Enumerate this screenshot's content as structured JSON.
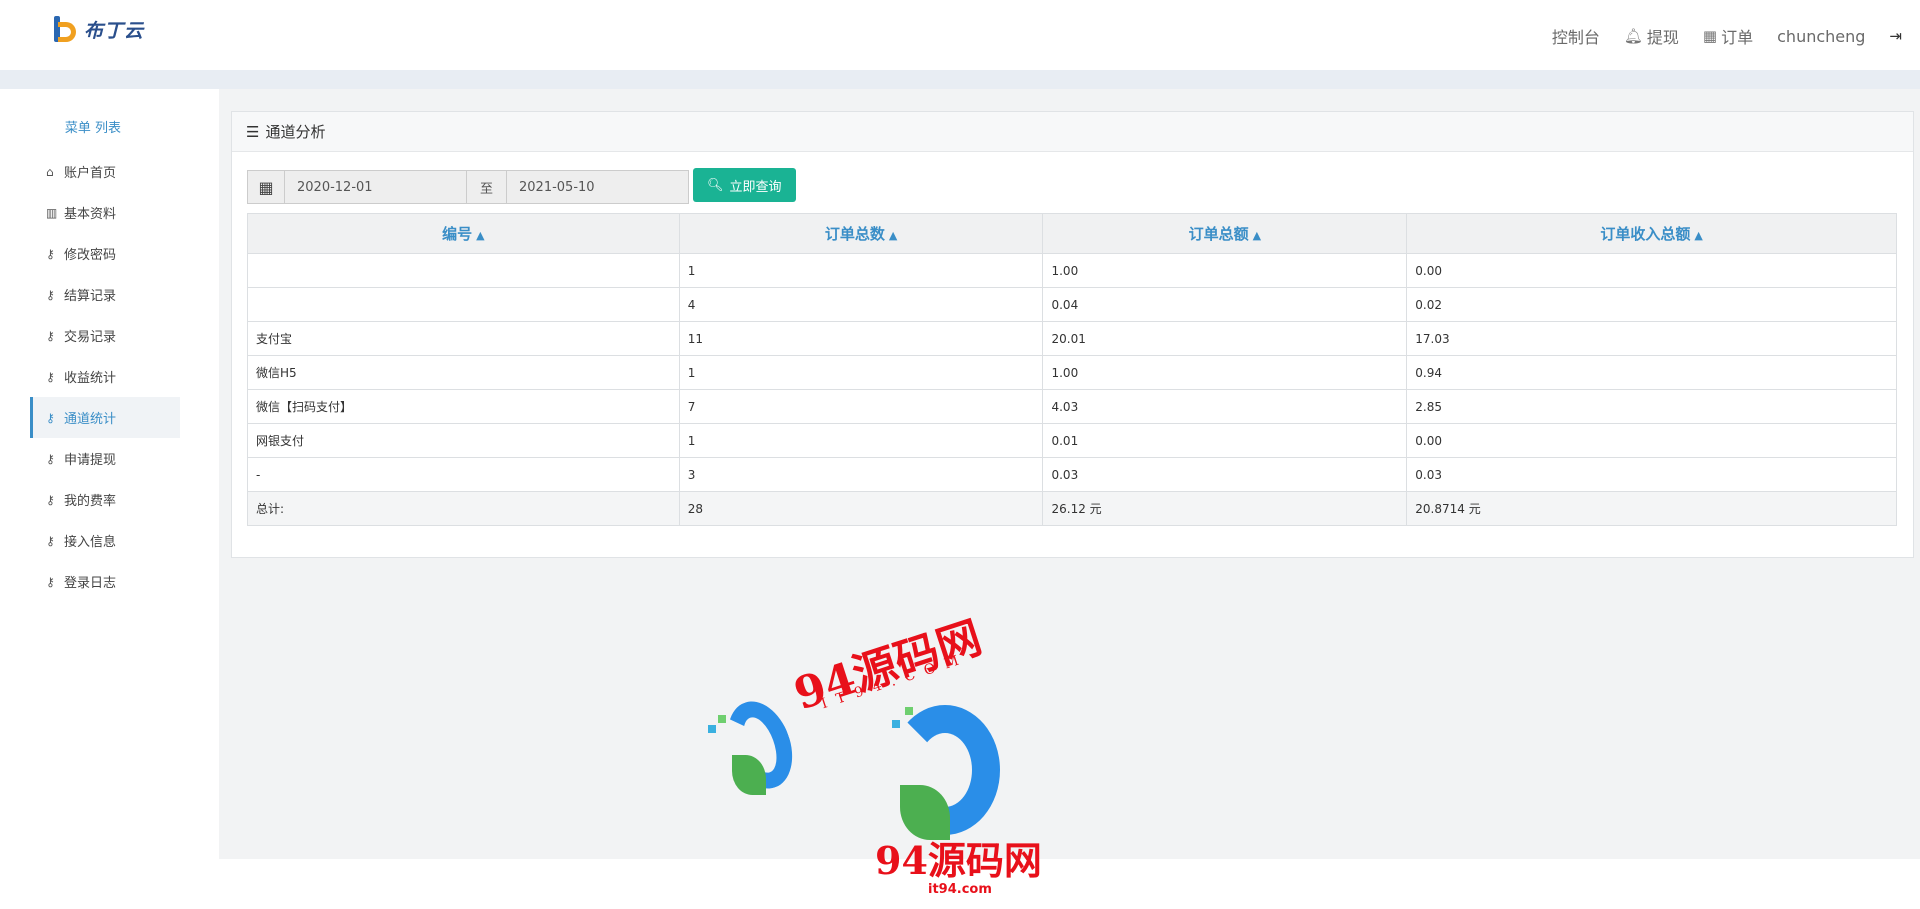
{
  "brand": {
    "logo_text": "布丁云"
  },
  "topnav": {
    "console": "控制台",
    "withdraw": "提现",
    "orders": "订单",
    "username": "chuncheng",
    "icons": {
      "withdraw": "bell-icon",
      "orders": "calendar-icon",
      "logout": "logout-icon"
    }
  },
  "sidebar": {
    "title": "菜单 列表",
    "items": [
      {
        "label": "账户首页",
        "icon": "home-icon",
        "active": false
      },
      {
        "label": "基本资料",
        "icon": "bar-chart-icon",
        "active": false
      },
      {
        "label": "修改密码",
        "icon": "key-icon",
        "active": false
      },
      {
        "label": "结算记录",
        "icon": "key-icon",
        "active": false
      },
      {
        "label": "交易记录",
        "icon": "key-icon",
        "active": false
      },
      {
        "label": "收益统计",
        "icon": "key-icon",
        "active": false
      },
      {
        "label": "通道统计",
        "icon": "key-icon",
        "active": true
      },
      {
        "label": "申请提现",
        "icon": "key-icon",
        "active": false
      },
      {
        "label": "我的费率",
        "icon": "key-icon",
        "active": false
      },
      {
        "label": "接入信息",
        "icon": "key-icon",
        "active": false
      },
      {
        "label": "登录日志",
        "icon": "key-icon",
        "active": false
      }
    ]
  },
  "panel": {
    "title": "通道分析",
    "filter": {
      "start_date": "2020-12-01",
      "separator": "至",
      "end_date": "2021-05-10",
      "query_button": "立即查询"
    },
    "table": {
      "headers": [
        "编号",
        "订单总数",
        "订单总额",
        "订单收入总额"
      ],
      "rows": [
        [
          "",
          "1",
          "1.00",
          "0.00"
        ],
        [
          "",
          "4",
          "0.04",
          "0.02"
        ],
        [
          "支付宝",
          "11",
          "20.01",
          "17.03"
        ],
        [
          "微信H5",
          "1",
          "1.00",
          "0.94"
        ],
        [
          "微信【扫码支付】",
          "7",
          "4.03",
          "2.85"
        ],
        [
          "网银支付",
          "1",
          "0.01",
          "0.00"
        ],
        [
          "-",
          "3",
          "0.03",
          "0.03"
        ]
      ],
      "total": {
        "label": "总计:",
        "count": "28",
        "amount": "26.12 元",
        "income": "20.8714 元"
      }
    }
  },
  "watermark": {
    "title": "94源码网",
    "subtitle": "IT94.COM",
    "url": "it94.com"
  },
  "colors": {
    "accent": "#3a8ec7",
    "button": "#1ab394",
    "total_count": "#c0392b",
    "total_income": "#3caa3c"
  }
}
